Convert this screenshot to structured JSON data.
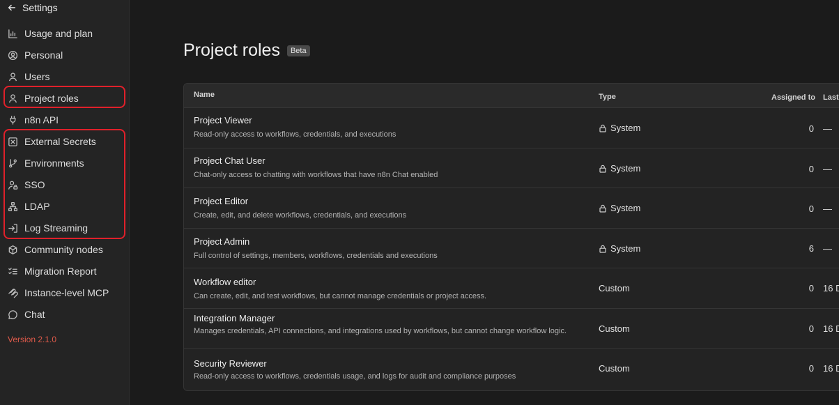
{
  "sidebar": {
    "title": "Settings",
    "items": [
      {
        "label": "Usage and plan",
        "icon": "bar-chart-icon"
      },
      {
        "label": "Personal",
        "icon": "user-circle-icon"
      },
      {
        "label": "Users",
        "icon": "user-icon"
      },
      {
        "label": "Project roles",
        "icon": "user-icon"
      },
      {
        "label": "n8n API",
        "icon": "plug-icon"
      },
      {
        "label": "External Secrets",
        "icon": "square-x-icon"
      },
      {
        "label": "Environments",
        "icon": "git-branch-icon"
      },
      {
        "label": "SSO",
        "icon": "user-lock-icon"
      },
      {
        "label": "LDAP",
        "icon": "network-icon"
      },
      {
        "label": "Log Streaming",
        "icon": "log-in-icon"
      },
      {
        "label": "Community nodes",
        "icon": "box-icon"
      },
      {
        "label": "Migration Report",
        "icon": "list-checks-icon"
      },
      {
        "label": "Instance-level MCP",
        "icon": "mcp-icon"
      },
      {
        "label": "Chat",
        "icon": "chat-icon"
      }
    ],
    "version": "Version 2.1.0"
  },
  "page": {
    "title": "Project roles",
    "badge": "Beta"
  },
  "table": {
    "headers": {
      "name": "Name",
      "type": "Type",
      "assigned": "Assigned to",
      "last": "Last"
    },
    "rows": [
      {
        "name": "Project Viewer",
        "desc": "Read-only access to workflows, credentials, and executions",
        "type": "System",
        "locked": true,
        "assigned": "0",
        "last": "—"
      },
      {
        "name": "Project Chat User",
        "desc": "Chat-only access to chatting with workflows that have n8n Chat enabled",
        "type": "System",
        "locked": true,
        "assigned": "0",
        "last": "—"
      },
      {
        "name": "Project Editor",
        "desc": "Create, edit, and delete workflows, credentials, and executions",
        "type": "System",
        "locked": true,
        "assigned": "0",
        "last": "—"
      },
      {
        "name": "Project Admin",
        "desc": "Full control of settings, members, workflows, credentials and executions",
        "type": "System",
        "locked": true,
        "assigned": "6",
        "last": "—"
      },
      {
        "name": "Workflow editor",
        "desc": "Can create, edit, and test workflows, but cannot manage credentials or project access.",
        "type": "Custom",
        "locked": false,
        "assigned": "0",
        "last": "16 D"
      },
      {
        "name": "Integration Manager",
        "desc": "Manages credentials, API connections, and integrations used by workflows, but cannot change workflow logic.",
        "type": "Custom",
        "locked": false,
        "assigned": "0",
        "last": "16 D"
      },
      {
        "name": "Security Reviewer",
        "desc": "Read-only access to workflows, credentials usage, and logs for audit and compliance purposes",
        "type": "Custom",
        "locked": false,
        "assigned": "0",
        "last": "16 D"
      }
    ]
  },
  "colors": {
    "highlight": "#e0202a",
    "version": "#e05a4a"
  }
}
